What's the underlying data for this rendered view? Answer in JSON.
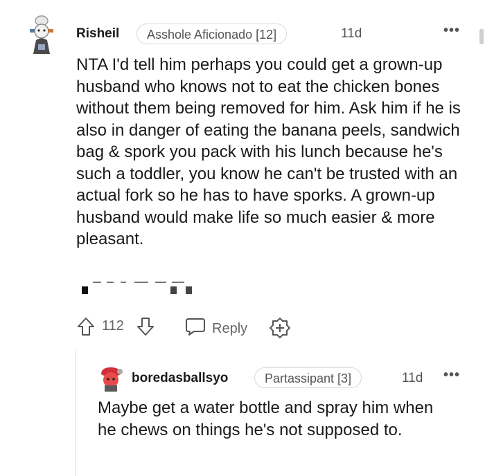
{
  "comment": {
    "username": "Risheil",
    "flair": "Asshole Aficionado [12]",
    "age": "11d",
    "more": "•••",
    "body": "NTA I'd tell him perhaps you could get a grown-up husband who knows not to eat the chicken bones without them being removed for him. Ask him if he is also in danger of eating the banana peels, sandwich bag & spork you pack with his lunch because he's such a toddler, you know he can't be trusted with an actual fork so he has to have sporks. A grown-up husband would make life so much easier & more pleasant.",
    "score": "112",
    "reply_label": "Reply",
    "icons": {
      "upvote": "upvote-icon",
      "downvote": "downvote-icon",
      "reply": "reply-icon",
      "award": "award-icon"
    }
  },
  "reply": {
    "username": "boredasballsyo",
    "flair": "Partassipant [3]",
    "age": "11d",
    "more": "•••",
    "body": "Maybe get a water bottle and spray him when he chews on things he's not supposed to."
  },
  "colors": {
    "text": "#1a1a1b",
    "meta": "#555555",
    "border": "#d7d9db"
  }
}
